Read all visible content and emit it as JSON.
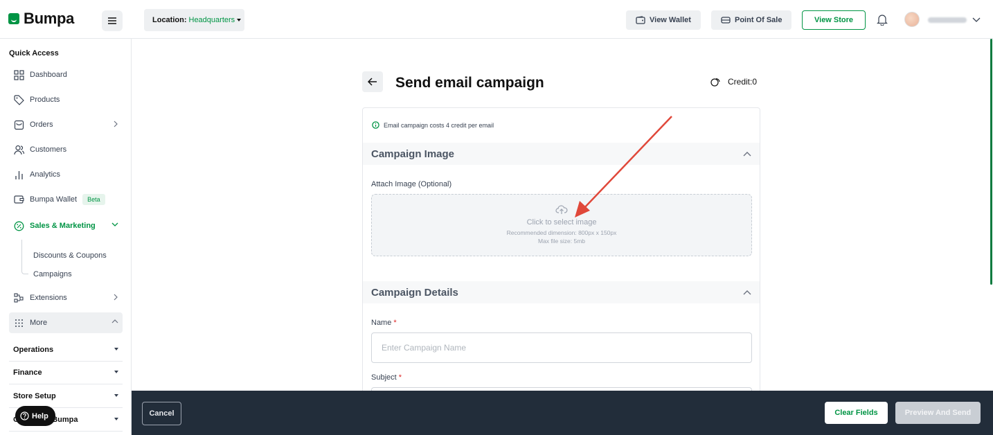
{
  "brand": {
    "name": "Bumpa",
    "accent": "#009444"
  },
  "topbar": {
    "location_label": "Location:",
    "location_value": "Headquarters",
    "view_wallet": "View Wallet",
    "point_of_sale": "Point Of Sale",
    "view_store": "View Store"
  },
  "sidebar": {
    "quick_access": "Quick Access",
    "dashboard": "Dashboard",
    "products": "Products",
    "orders": "Orders",
    "customers": "Customers",
    "analytics": "Analytics",
    "wallet": "Bumpa Wallet",
    "wallet_badge": "Beta",
    "sales_marketing": "Sales & Marketing",
    "discounts": "Discounts & Coupons",
    "campaigns": "Campaigns",
    "extensions": "Extensions",
    "more": "More",
    "operations": "Operations",
    "finance": "Finance",
    "store_setup": "Store Setup",
    "get_started": "Grow with Bumpa",
    "help": "Help"
  },
  "page": {
    "title": "Send email campaign",
    "credit": "Credit:0",
    "notice": "Email campaign costs 4 credit per email"
  },
  "campaign_image": {
    "heading": "Campaign Image",
    "attach_label": "Attach Image (Optional)",
    "dropzone_main": "Click to select image",
    "dropzone_dim": "Recommended dimension: 800px x 150px",
    "dropzone_size": "Max file size: 5mb"
  },
  "campaign_details": {
    "heading": "Campaign Details",
    "name_label": "Name",
    "name_placeholder": "Enter Campaign Name",
    "subject_label": "Subject",
    "required_mark": "*"
  },
  "footer": {
    "cancel": "Cancel",
    "clear": "Clear Fields",
    "preview": "Preview And Send"
  }
}
